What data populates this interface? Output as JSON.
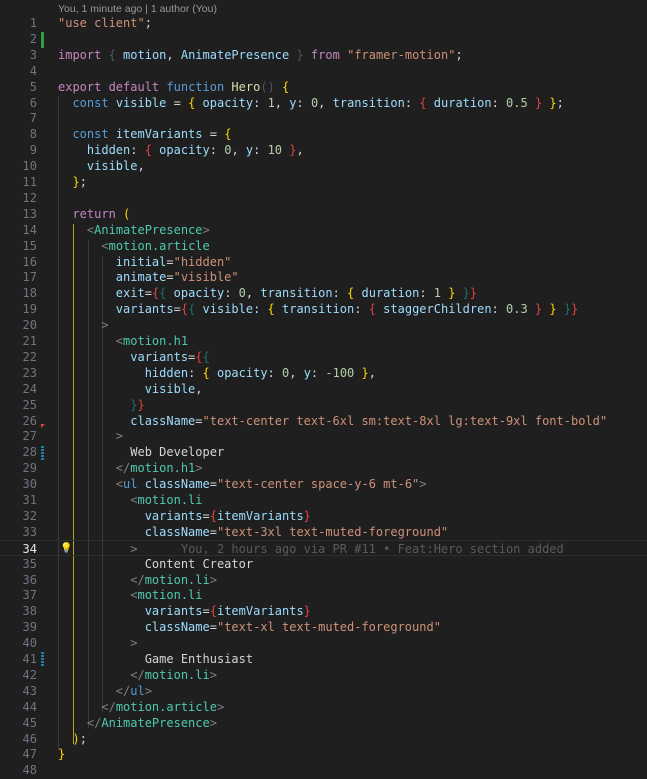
{
  "codelens": "You, 1 minute ago | 1 author (You)",
  "active_line": 34,
  "blame_inline": "You, 2 hours ago via PR #11 • Feat:Hero section added",
  "lines": [
    [
      [
        "s",
        "\"use client\""
      ],
      [
        "p",
        ";"
      ]
    ],
    [],
    [
      [
        "kw",
        "import"
      ],
      [
        "p",
        " "
      ],
      [
        "dim",
        "{"
      ],
      [
        "v",
        " motion"
      ],
      [
        "p",
        ", "
      ],
      [
        "v",
        "AnimatePresence "
      ],
      [
        "dim",
        "}"
      ],
      [
        "p",
        " "
      ],
      [
        "kw",
        "from"
      ],
      [
        "p",
        " "
      ],
      [
        "s",
        "\"framer-motion\""
      ],
      [
        "p",
        ";"
      ]
    ],
    [],
    [
      [
        "kw",
        "export default"
      ],
      [
        "p",
        " "
      ],
      [
        "st",
        "function"
      ],
      [
        "p",
        " "
      ],
      [
        "f",
        "Hero"
      ],
      [
        "dim",
        "()"
      ],
      [
        "p",
        " "
      ],
      [
        "b1",
        "{"
      ]
    ],
    [
      [
        "p",
        "  "
      ],
      [
        "st",
        "const"
      ],
      [
        "p",
        " "
      ],
      [
        "v",
        "visible"
      ],
      [
        "p",
        " = "
      ],
      [
        "b1",
        "{"
      ],
      [
        "v",
        " opacity"
      ],
      [
        "p",
        ": "
      ],
      [
        "n",
        "1"
      ],
      [
        "p",
        ", "
      ],
      [
        "v",
        "y"
      ],
      [
        "p",
        ": "
      ],
      [
        "n",
        "0"
      ],
      [
        "p",
        ", "
      ],
      [
        "v",
        "transition"
      ],
      [
        "p",
        ": "
      ],
      [
        "jr",
        "{"
      ],
      [
        "v",
        " duration"
      ],
      [
        "p",
        ": "
      ],
      [
        "n",
        "0.5"
      ],
      [
        "jr",
        " }"
      ],
      [
        "b1",
        " }"
      ],
      [
        "p",
        ";"
      ]
    ],
    [],
    [
      [
        "p",
        "  "
      ],
      [
        "st",
        "const"
      ],
      [
        "p",
        " "
      ],
      [
        "v",
        "itemVariants"
      ],
      [
        "p",
        " = "
      ],
      [
        "b1",
        "{"
      ]
    ],
    [
      [
        "p",
        "    "
      ],
      [
        "v",
        "hidden"
      ],
      [
        "p",
        ": "
      ],
      [
        "jr",
        "{"
      ],
      [
        "v",
        " opacity"
      ],
      [
        "p",
        ": "
      ],
      [
        "n",
        "0"
      ],
      [
        "p",
        ", "
      ],
      [
        "v",
        "y"
      ],
      [
        "p",
        ": "
      ],
      [
        "n",
        "10"
      ],
      [
        "jr",
        " }"
      ],
      [
        "p",
        ","
      ]
    ],
    [
      [
        "p",
        "    "
      ],
      [
        "v",
        "visible"
      ],
      [
        "p",
        ","
      ]
    ],
    [
      [
        "p",
        "  "
      ],
      [
        "b1",
        "}"
      ],
      [
        "p",
        ";"
      ]
    ],
    [],
    [
      [
        "p",
        "  "
      ],
      [
        "kw",
        "return"
      ],
      [
        "p",
        " "
      ],
      [
        "b1",
        "("
      ]
    ],
    [
      [
        "p",
        "    "
      ],
      [
        "pt",
        "<"
      ],
      [
        "tg",
        "AnimatePresence"
      ],
      [
        "pt",
        ">"
      ]
    ],
    [
      [
        "p",
        "      "
      ],
      [
        "pt",
        "<"
      ],
      [
        "tg",
        "motion.article"
      ]
    ],
    [
      [
        "p",
        "        "
      ],
      [
        "v",
        "initial"
      ],
      [
        "p",
        "="
      ],
      [
        "s",
        "\"hidden\""
      ]
    ],
    [
      [
        "p",
        "        "
      ],
      [
        "v",
        "animate"
      ],
      [
        "p",
        "="
      ],
      [
        "s",
        "\"visible\""
      ]
    ],
    [
      [
        "p",
        "        "
      ],
      [
        "v",
        "exit"
      ],
      [
        "p",
        "="
      ],
      [
        "jr",
        "{"
      ],
      [
        "jt",
        "{"
      ],
      [
        "v",
        " opacity"
      ],
      [
        "p",
        ": "
      ],
      [
        "n",
        "0"
      ],
      [
        "p",
        ", "
      ],
      [
        "v",
        "transition"
      ],
      [
        "p",
        ": "
      ],
      [
        "b1",
        "{"
      ],
      [
        "v",
        " duration"
      ],
      [
        "p",
        ": "
      ],
      [
        "n",
        "1"
      ],
      [
        "b1",
        " }"
      ],
      [
        "jt",
        " }"
      ],
      [
        "jr",
        "}"
      ]
    ],
    [
      [
        "p",
        "        "
      ],
      [
        "v",
        "variants"
      ],
      [
        "p",
        "="
      ],
      [
        "jr",
        "{"
      ],
      [
        "jt",
        "{"
      ],
      [
        "v",
        " visible"
      ],
      [
        "p",
        ": "
      ],
      [
        "b1",
        "{"
      ],
      [
        "v",
        " transition"
      ],
      [
        "p",
        ": "
      ],
      [
        "jr",
        "{"
      ],
      [
        "v",
        " staggerChildren"
      ],
      [
        "p",
        ": "
      ],
      [
        "n",
        "0.3"
      ],
      [
        "jr",
        " }"
      ],
      [
        "b1",
        " }"
      ],
      [
        "jt",
        " }"
      ],
      [
        "jr",
        "}"
      ]
    ],
    [
      [
        "p",
        "      "
      ],
      [
        "pt",
        ">"
      ]
    ],
    [
      [
        "p",
        "        "
      ],
      [
        "pt",
        "<"
      ],
      [
        "tg",
        "motion.h1"
      ]
    ],
    [
      [
        "p",
        "          "
      ],
      [
        "v",
        "variants"
      ],
      [
        "p",
        "="
      ],
      [
        "jr",
        "{"
      ],
      [
        "jt",
        "{"
      ]
    ],
    [
      [
        "p",
        "            "
      ],
      [
        "v",
        "hidden"
      ],
      [
        "p",
        ": "
      ],
      [
        "b1",
        "{"
      ],
      [
        "v",
        " opacity"
      ],
      [
        "p",
        ": "
      ],
      [
        "n",
        "0"
      ],
      [
        "p",
        ", "
      ],
      [
        "v",
        "y"
      ],
      [
        "p",
        ": "
      ],
      [
        "n",
        "-100"
      ],
      [
        "b1",
        " }"
      ],
      [
        "p",
        ","
      ]
    ],
    [
      [
        "p",
        "            "
      ],
      [
        "v",
        "visible"
      ],
      [
        "p",
        ","
      ]
    ],
    [
      [
        "p",
        "          "
      ],
      [
        "jt",
        "}"
      ],
      [
        "jr",
        "}"
      ]
    ],
    [
      [
        "p",
        "          "
      ],
      [
        "v",
        "className"
      ],
      [
        "p",
        "="
      ],
      [
        "s",
        "\"text-center text-6xl sm:text-8xl lg:text-9xl font-bold\""
      ]
    ],
    [
      [
        "p",
        "        "
      ],
      [
        "pt",
        ">"
      ]
    ],
    [
      [
        "p",
        "          "
      ],
      [
        "t",
        "Web Developer"
      ]
    ],
    [
      [
        "p",
        "        "
      ],
      [
        "pt",
        "</"
      ],
      [
        "tg",
        "motion.h1"
      ],
      [
        "pt",
        ">"
      ]
    ],
    [
      [
        "p",
        "        "
      ],
      [
        "pt",
        "<"
      ],
      [
        "st",
        "ul"
      ],
      [
        "p",
        " "
      ],
      [
        "v",
        "className"
      ],
      [
        "p",
        "="
      ],
      [
        "s",
        "\"text-center space-y-6 mt-6\""
      ],
      [
        "pt",
        ">"
      ]
    ],
    [
      [
        "p",
        "          "
      ],
      [
        "pt",
        "<"
      ],
      [
        "tg",
        "motion.li"
      ]
    ],
    [
      [
        "p",
        "            "
      ],
      [
        "v",
        "variants"
      ],
      [
        "p",
        "="
      ],
      [
        "jr",
        "{"
      ],
      [
        "v",
        "itemVariants"
      ],
      [
        "jr",
        "}"
      ]
    ],
    [
      [
        "p",
        "            "
      ],
      [
        "v",
        "className"
      ],
      [
        "p",
        "="
      ],
      [
        "s",
        "\"text-3xl text-muted-foreground\""
      ]
    ],
    [
      [
        "p",
        "          "
      ],
      [
        "pt",
        ">"
      ],
      [
        "ghost",
        "      "
      ]
    ],
    [
      [
        "p",
        "            "
      ],
      [
        "t",
        "Content Creator"
      ]
    ],
    [
      [
        "p",
        "          "
      ],
      [
        "pt",
        "</"
      ],
      [
        "tg",
        "motion.li"
      ],
      [
        "pt",
        ">"
      ]
    ],
    [
      [
        "p",
        "          "
      ],
      [
        "pt",
        "<"
      ],
      [
        "tg",
        "motion.li"
      ]
    ],
    [
      [
        "p",
        "            "
      ],
      [
        "v",
        "variants"
      ],
      [
        "p",
        "="
      ],
      [
        "jr",
        "{"
      ],
      [
        "v",
        "itemVariants"
      ],
      [
        "jr",
        "}"
      ]
    ],
    [
      [
        "p",
        "            "
      ],
      [
        "v",
        "className"
      ],
      [
        "p",
        "="
      ],
      [
        "s",
        "\"text-xl text-muted-foreground\""
      ]
    ],
    [
      [
        "p",
        "          "
      ],
      [
        "pt",
        ">"
      ]
    ],
    [
      [
        "p",
        "            "
      ],
      [
        "t",
        "Game Enthusiast"
      ]
    ],
    [
      [
        "p",
        "          "
      ],
      [
        "pt",
        "</"
      ],
      [
        "tg",
        "motion.li"
      ],
      [
        "pt",
        ">"
      ]
    ],
    [
      [
        "p",
        "        "
      ],
      [
        "pt",
        "</"
      ],
      [
        "st",
        "ul"
      ],
      [
        "pt",
        ">"
      ]
    ],
    [
      [
        "p",
        "      "
      ],
      [
        "pt",
        "</"
      ],
      [
        "tg",
        "motion.article"
      ],
      [
        "pt",
        ">"
      ]
    ],
    [
      [
        "p",
        "    "
      ],
      [
        "pt",
        "</"
      ],
      [
        "tg",
        "AnimatePresence"
      ],
      [
        "pt",
        ">"
      ]
    ],
    [
      [
        "p",
        "  "
      ],
      [
        "b1",
        ")"
      ],
      [
        "p",
        ";"
      ]
    ],
    [
      [
        "b1",
        "}"
      ]
    ],
    []
  ]
}
